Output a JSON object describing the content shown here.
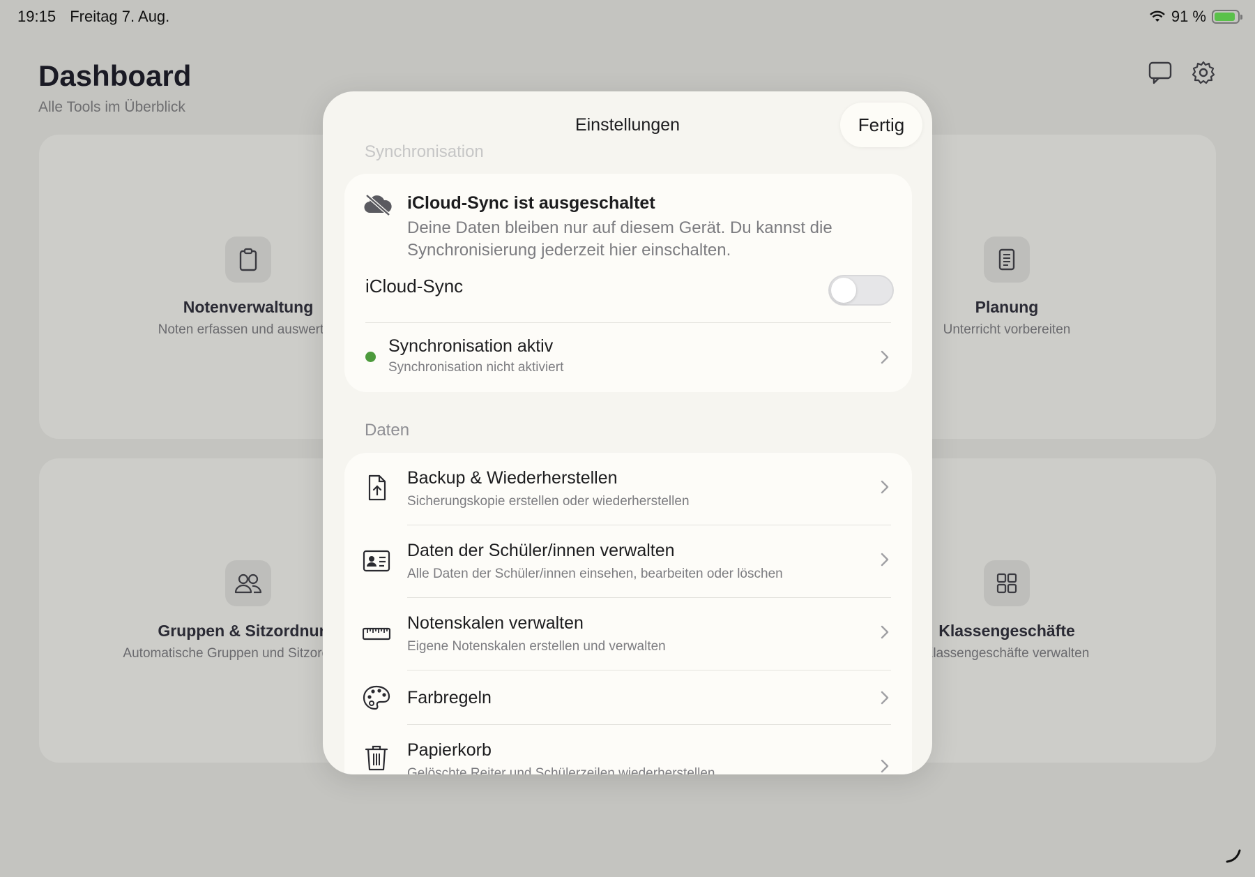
{
  "status_bar": {
    "time": "19:15",
    "date": "Freitag 7. Aug.",
    "battery_percent": "91 %",
    "battery_level": 0.91
  },
  "header": {
    "title": "Dashboard",
    "subtitle": "Alle Tools im Überblick"
  },
  "cards": [
    {
      "title": "Notenverwaltung",
      "subtitle": "Noten erfassen und auswerten",
      "icon": "clipboard-icon"
    },
    {
      "title": "Planung",
      "subtitle": "Unterricht vorbereiten",
      "icon": "document-icon"
    },
    {
      "title": "Gruppen & Sitzordnung",
      "subtitle": "Automatische Gruppen und Sitzordnungen",
      "icon": "people-icon"
    },
    {
      "title": "Klassengeschäfte",
      "subtitle": "Klassengeschäfte verwalten",
      "icon": "grid-icon"
    }
  ],
  "modal": {
    "title": "Einstellungen",
    "done_label": "Fertig",
    "sync_section": {
      "label": "Synchronisation",
      "status_title": "iCloud-Sync ist ausgeschaltet",
      "status_desc": "Deine Daten bleiben nur auf diesem Gerät. Du kannst die Synchronisierung jederzeit hier einschalten.",
      "toggle_label": "iCloud-Sync",
      "toggle_on": false,
      "row_title": "Synchronisation aktiv",
      "row_sub": "Synchronisation nicht aktiviert"
    },
    "data_section": {
      "label": "Daten",
      "rows": [
        {
          "title": "Backup & Wiederherstellen",
          "sub": "Sicherungskopie erstellen oder wiederherstellen",
          "icon": "backup-doc-icon"
        },
        {
          "title": "Daten der Schüler/innen verwalten",
          "sub": "Alle Daten der Schüler/innen einsehen, bearbeiten oder löschen",
          "icon": "id-card-icon"
        },
        {
          "title": "Notenskalen verwalten",
          "sub": "Eigene Notenskalen erstellen und verwalten",
          "icon": "ruler-icon"
        },
        {
          "title": "Farbregeln",
          "sub": "",
          "icon": "palette-icon"
        },
        {
          "title": "Papierkorb",
          "sub": "Gelöschte Reiter und Schülerzeilen wiederherstellen",
          "icon": "trash-icon"
        }
      ]
    }
  },
  "colors": {
    "background": "#c4c4c0",
    "modal": "#f6f5f0",
    "status_green": "#4c9a3c"
  }
}
